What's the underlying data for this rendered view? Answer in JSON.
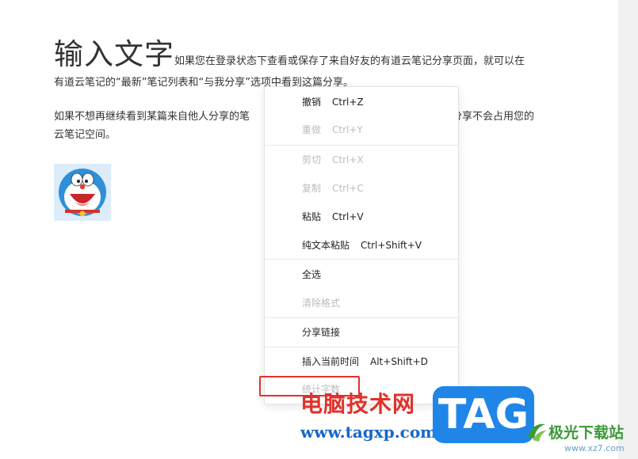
{
  "document": {
    "title": "输入文字",
    "para1_line1": "如果您在登录状态下查看或保存了来自好友的有道云笔记分享页面，就可以在",
    "para1_line2": "有道云笔记的“最新”笔记列表和“与我分享”选项中看到这篇分享。",
    "para2_line1_left": "如果不想再继续看到某篇来自他人分享的笔",
    "para2_line1_right": "分享不会占用您的",
    "para2_line2": "云笔记空间。"
  },
  "context_menu": {
    "items": [
      {
        "label": "撤销",
        "shortcut": "Ctrl+Z",
        "enabled": true
      },
      {
        "label": "重做",
        "shortcut": "Ctrl+Y",
        "enabled": false
      },
      {
        "label": "剪切",
        "shortcut": "Ctrl+X",
        "enabled": false
      },
      {
        "label": "复制",
        "shortcut": "Ctrl+C",
        "enabled": false
      },
      {
        "label": "粘贴",
        "shortcut": "Ctrl+V",
        "enabled": true
      },
      {
        "label": "纯文本粘贴",
        "shortcut": "Ctrl+Shift+V",
        "enabled": true
      },
      {
        "label": "全选",
        "shortcut": "",
        "enabled": true
      },
      {
        "label": "清除格式",
        "shortcut": "",
        "enabled": false
      },
      {
        "label": "分享链接",
        "shortcut": "",
        "enabled": true
      },
      {
        "label": "插入当前时间",
        "shortcut": "Alt+Shift+D",
        "enabled": true
      },
      {
        "label": "统计字数",
        "shortcut": "",
        "enabled": false
      }
    ]
  },
  "watermarks": {
    "site_cn": "电脑技术网",
    "site_url": "www.tagxp.com",
    "tag_logo": "TAG",
    "xz_cn": "极光下载站",
    "xz_url": "www.xz7.com"
  },
  "colors": {
    "highlight_box": "#e0322b",
    "tag_blue": "#1f86e8",
    "disabled_text": "#bdbdbd"
  },
  "icons": {
    "image": "doraemon-image",
    "xz_logo": "aurora-logo-icon"
  }
}
